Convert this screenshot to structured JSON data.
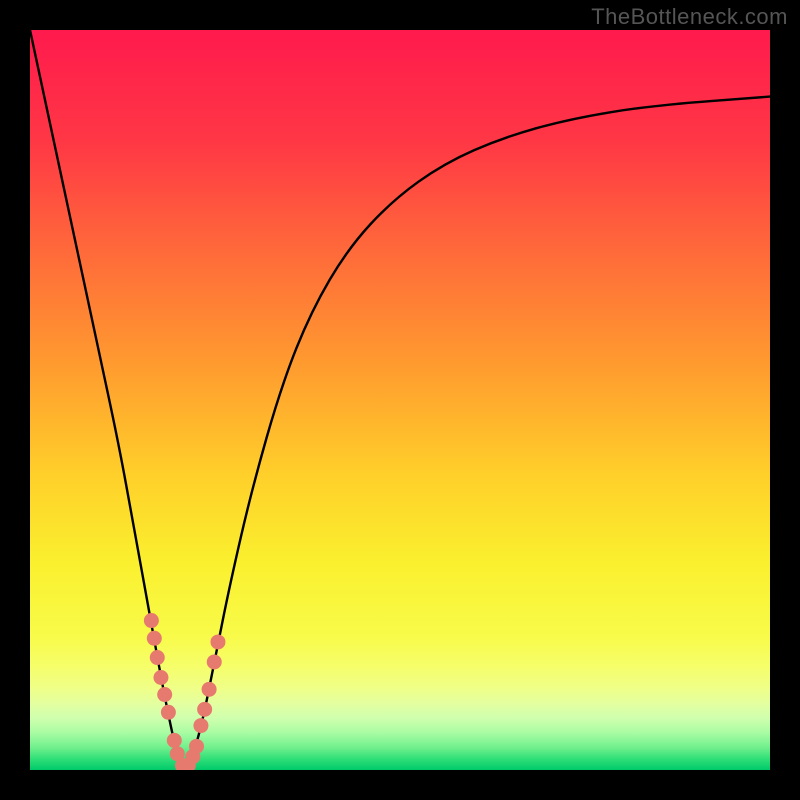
{
  "attribution": "TheBottleneck.com",
  "chart_data": {
    "type": "line",
    "title": "",
    "xlabel": "",
    "ylabel": "",
    "xlim": [
      0,
      100
    ],
    "ylim": [
      0,
      100
    ],
    "grid": false,
    "series": [
      {
        "name": "bottleneck-curve",
        "x": [
          0,
          3,
          6,
          9,
          12,
          14,
          16,
          17.8,
          19.0,
          19.8,
          20.6,
          21.4,
          22.2,
          23.4,
          25.0,
          27.0,
          30.0,
          34.0,
          38.0,
          43.0,
          49.0,
          56.0,
          64.0,
          73.0,
          84.0,
          100.0
        ],
        "y": [
          100,
          86,
          72,
          58,
          44,
          33,
          22,
          12.0,
          6.0,
          2.5,
          0.6,
          0.6,
          2.5,
          7.0,
          15.0,
          25.0,
          38.0,
          52.0,
          62.0,
          70.5,
          77.0,
          82.0,
          85.5,
          88.0,
          89.8,
          91.0
        ]
      }
    ],
    "markers": {
      "name": "highlight-dots",
      "color": "#e77a6f",
      "points": [
        {
          "x": 16.4,
          "y": 20.2
        },
        {
          "x": 16.8,
          "y": 17.8
        },
        {
          "x": 17.2,
          "y": 15.2
        },
        {
          "x": 17.7,
          "y": 12.5
        },
        {
          "x": 18.2,
          "y": 10.2
        },
        {
          "x": 18.7,
          "y": 7.8
        },
        {
          "x": 19.5,
          "y": 4.0
        },
        {
          "x": 19.9,
          "y": 2.2
        },
        {
          "x": 20.6,
          "y": 0.6
        },
        {
          "x": 21.4,
          "y": 0.6
        },
        {
          "x": 22.0,
          "y": 1.8
        },
        {
          "x": 22.5,
          "y": 3.2
        },
        {
          "x": 23.1,
          "y": 6.0
        },
        {
          "x": 23.6,
          "y": 8.2
        },
        {
          "x": 24.2,
          "y": 10.9
        },
        {
          "x": 24.9,
          "y": 14.6
        },
        {
          "x": 25.4,
          "y": 17.3
        }
      ]
    },
    "background_gradient": {
      "stops": [
        {
          "y": 100,
          "color": "#ff1a4d"
        },
        {
          "y": 85,
          "color": "#ff3745"
        },
        {
          "y": 70,
          "color": "#ff6a3a"
        },
        {
          "y": 55,
          "color": "#ff9a2f"
        },
        {
          "y": 40,
          "color": "#ffcf2a"
        },
        {
          "y": 28,
          "color": "#faf02e"
        },
        {
          "y": 18,
          "color": "#f8fb4a"
        },
        {
          "y": 14,
          "color": "#f6fe6a"
        },
        {
          "y": 11,
          "color": "#efff88"
        },
        {
          "y": 9,
          "color": "#e4ffa0"
        },
        {
          "y": 7,
          "color": "#cfffae"
        },
        {
          "y": 5,
          "color": "#a8fca3"
        },
        {
          "y": 3,
          "color": "#6fef8c"
        },
        {
          "y": 1.5,
          "color": "#30df78"
        },
        {
          "y": 0,
          "color": "#00c96a"
        }
      ]
    }
  }
}
